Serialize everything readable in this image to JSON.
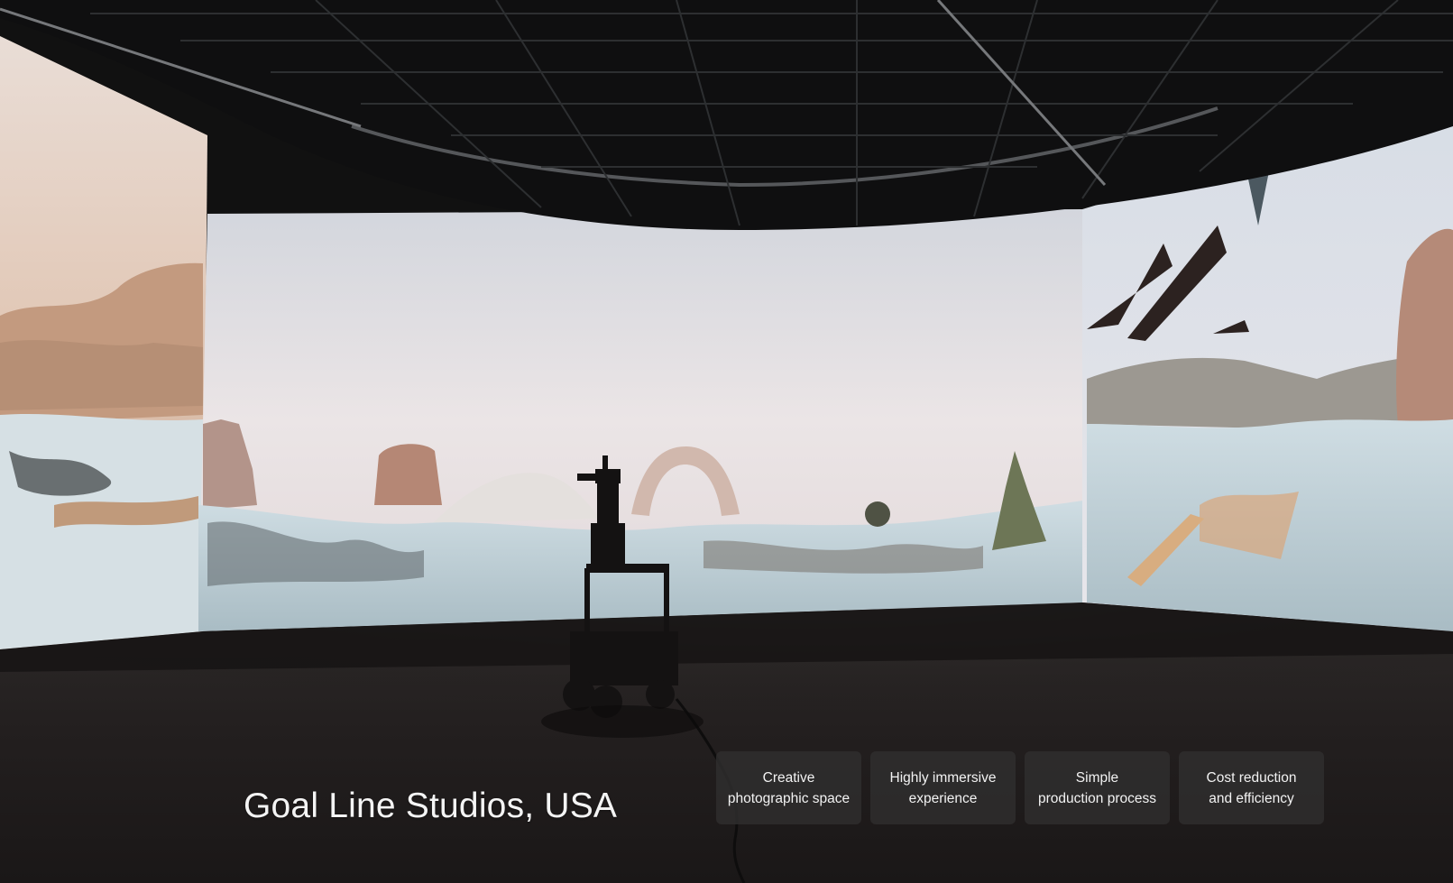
{
  "hero": {
    "caption": "Goal Line Studios, USA"
  },
  "features": [
    {
      "label": "Creative\nphotographic space"
    },
    {
      "label": "Highly immersive\nexperience"
    },
    {
      "label": "Simple\nproduction process"
    },
    {
      "label": "Cost reduction\nand efficiency"
    }
  ],
  "colors": {
    "card_background": "#302e2e",
    "text": "#f4f4f4"
  }
}
